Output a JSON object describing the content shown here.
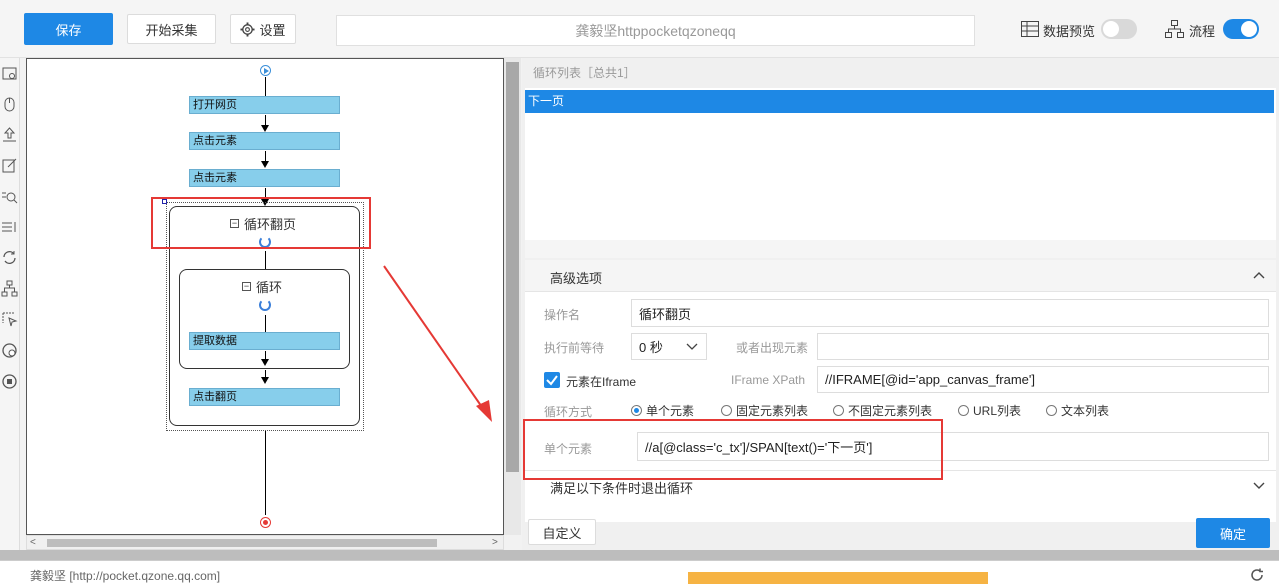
{
  "toolbar": {
    "save_label": "保存",
    "start_label": "开始采集",
    "settings_label": "设置",
    "url_text": "龚毅坚httppocketqzoneqq",
    "data_preview_label": "数据预览",
    "flow_label": "流程",
    "data_preview_on": false,
    "flow_on": true
  },
  "flow": {
    "nodes": [
      "打开网页",
      "点击元素",
      "点击元素"
    ],
    "loop_outer_title": "循环翻页",
    "loop_inner_title": "循环",
    "inner_node": "提取数据",
    "pagination_node": "点击翻页"
  },
  "loop_list": {
    "header": "循环列表［总共1］",
    "items": [
      "下一页"
    ]
  },
  "advanced": {
    "title": "高级选项",
    "op_name_label": "操作名",
    "op_name_value": "循环翻页",
    "wait_label": "执行前等待",
    "wait_value": "0 秒",
    "or_appear_label": "或者出现元素",
    "or_appear_value": "",
    "in_iframe_label": "元素在Iframe",
    "iframe_xpath_label": "IFrame XPath",
    "iframe_xpath_value": "//IFRAME[@id='app_canvas_frame']",
    "loop_mode_label": "循环方式",
    "loop_modes": [
      "单个元素",
      "固定元素列表",
      "不固定元素列表",
      "URL列表",
      "文本列表"
    ],
    "loop_mode_selected": 0,
    "single_element_label": "单个元素",
    "single_element_value": "//a[@class='c_tx']/SPAN[text()='下一页']",
    "exit_condition_label": "满足以下条件时退出循环"
  },
  "footer": {
    "custom_label": "自定义",
    "confirm_label": "确定"
  },
  "status": {
    "text": "龚毅坚 [http://pocket.qzone.qq.com]"
  },
  "colors": {
    "accent": "#1e88e5",
    "node_fill": "#87ceeb",
    "highlight_border": "#e53935"
  }
}
